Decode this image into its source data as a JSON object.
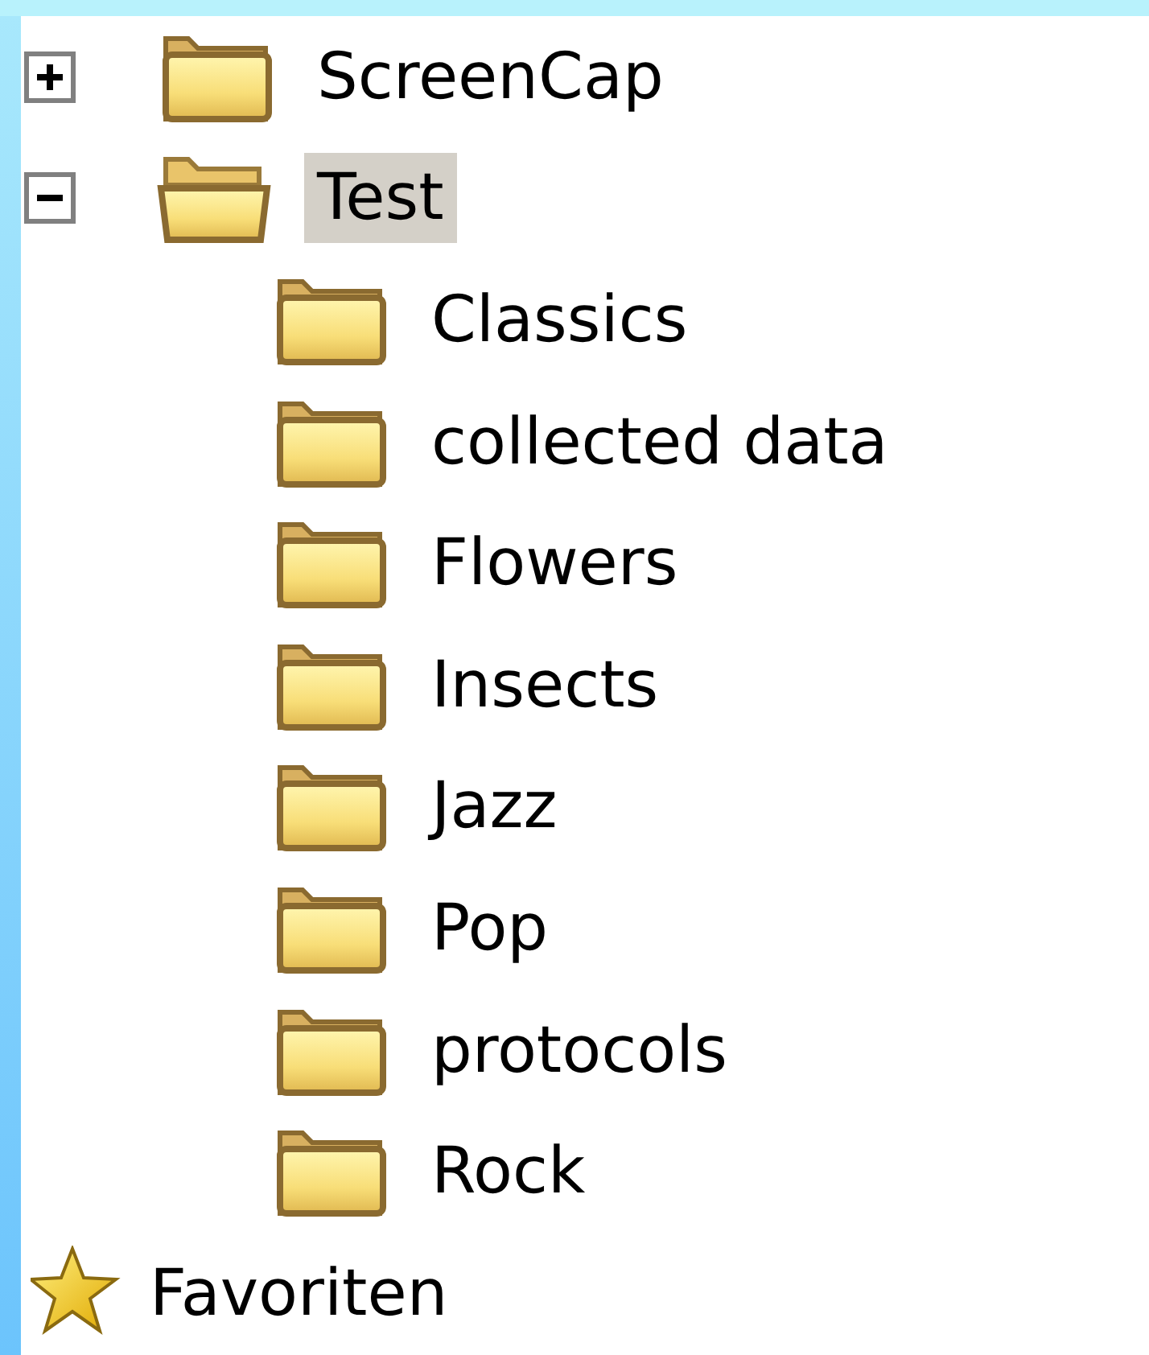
{
  "tree": [
    {
      "label": "ScreenCap",
      "kind": "folder",
      "expanded": false,
      "selected": false
    },
    {
      "label": "Test",
      "kind": "folder",
      "expanded": true,
      "selected": true,
      "children": [
        {
          "label": "Classics",
          "kind": "folder",
          "selected": false
        },
        {
          "label": "collected data",
          "kind": "folder",
          "selected": false
        },
        {
          "label": "Flowers",
          "kind": "folder",
          "selected": false
        },
        {
          "label": "Insects",
          "kind": "folder",
          "selected": false
        },
        {
          "label": "Jazz",
          "kind": "folder",
          "selected": false
        },
        {
          "label": "Pop",
          "kind": "folder",
          "selected": false
        },
        {
          "label": "protocols",
          "kind": "folder",
          "selected": false
        },
        {
          "label": "Rock",
          "kind": "folder",
          "selected": false
        }
      ]
    },
    {
      "label": "Favoriten",
      "kind": "favorites",
      "selected": false
    }
  ]
}
